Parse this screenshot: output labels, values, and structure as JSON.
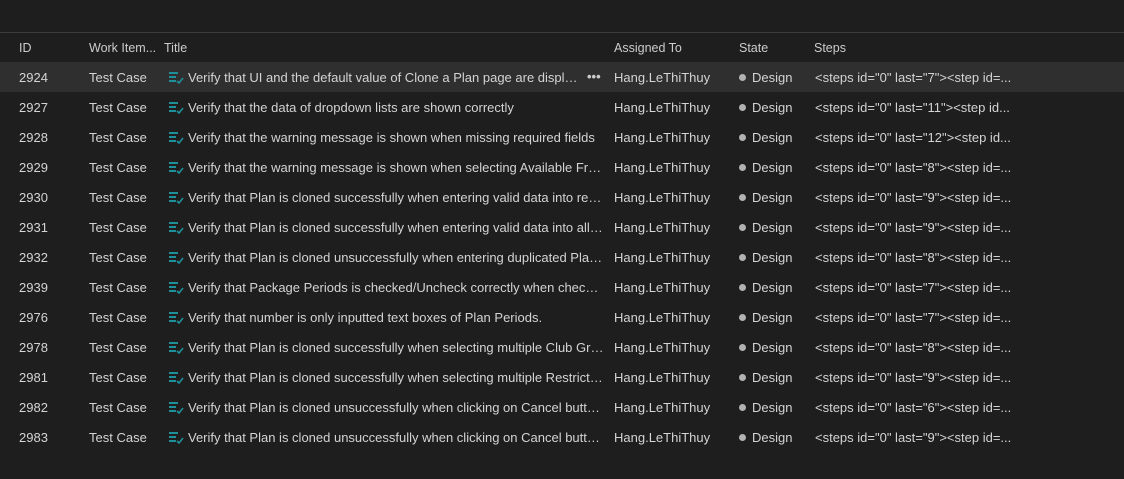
{
  "columns": {
    "id": "ID",
    "work_item_type": "Work Item...",
    "title": "Title",
    "assigned_to": "Assigned To",
    "state": "State",
    "steps": "Steps"
  },
  "colors": {
    "background": "#1e1e1e",
    "selected_row": "#2f2f2f",
    "icon_teal": "#1f8f9a",
    "state_dot": "#b2b2b2"
  },
  "rows": [
    {
      "id": "2924",
      "type": "Test Case",
      "title": "Verify that UI and the default value of Clone a Plan page are displa...",
      "assigned": "Hang.LeThiThuy",
      "state": "Design",
      "steps": "<steps id=\"0\" last=\"7\"><step id=...",
      "more": "•••"
    },
    {
      "id": "2927",
      "type": "Test Case",
      "title": "Verify that the data of dropdown lists are shown correctly",
      "assigned": "Hang.LeThiThuy",
      "state": "Design",
      "steps": "<steps id=\"0\" last=\"11\"><step id..."
    },
    {
      "id": "2928",
      "type": "Test Case",
      "title": "Verify that the warning message is shown when missing required fields",
      "assigned": "Hang.LeThiThuy",
      "state": "Design",
      "steps": "<steps id=\"0\" last=\"12\"><step id..."
    },
    {
      "id": "2929",
      "type": "Test Case",
      "title": "Verify that the warning message is shown when selecting Available Fro...",
      "assigned": "Hang.LeThiThuy",
      "state": "Design",
      "steps": "<steps id=\"0\" last=\"8\"><step id=..."
    },
    {
      "id": "2930",
      "type": "Test Case",
      "title": "Verify that Plan is cloned successfully when entering valid data into req...",
      "assigned": "Hang.LeThiThuy",
      "state": "Design",
      "steps": "<steps id=\"0\" last=\"9\"><step id=..."
    },
    {
      "id": "2931",
      "type": "Test Case",
      "title": "Verify that Plan is cloned successfully when entering valid data into all f...",
      "assigned": "Hang.LeThiThuy",
      "state": "Design",
      "steps": "<steps id=\"0\" last=\"9\"><step id=..."
    },
    {
      "id": "2932",
      "type": "Test Case",
      "title": "Verify that Plan is cloned unsuccessfully when entering duplicated Plan ...",
      "assigned": "Hang.LeThiThuy",
      "state": "Design",
      "steps": "<steps id=\"0\" last=\"8\"><step id=..."
    },
    {
      "id": "2939",
      "type": "Test Case",
      "title": "Verify that Package Periods is checked/Uncheck correctly when check/...",
      "assigned": "Hang.LeThiThuy",
      "state": "Design",
      "steps": "<steps id=\"0\" last=\"7\"><step id=..."
    },
    {
      "id": "2976",
      "type": "Test Case",
      "title": "Verify that number is only inputted text boxes of Plan Periods.",
      "assigned": "Hang.LeThiThuy",
      "state": "Design",
      "steps": "<steps id=\"0\" last=\"7\"><step id=..."
    },
    {
      "id": "2978",
      "type": "Test Case",
      "title": "Verify that Plan is cloned successfully when selecting multiple Club Gro...",
      "assigned": "Hang.LeThiThuy",
      "state": "Design",
      "steps": "<steps id=\"0\" last=\"8\"><step id=..."
    },
    {
      "id": "2981",
      "type": "Test Case",
      "title": "Verify that Plan is cloned successfully when selecting multiple Restrictio...",
      "assigned": "Hang.LeThiThuy",
      "state": "Design",
      "steps": "<steps id=\"0\" last=\"9\"><step id=..."
    },
    {
      "id": "2982",
      "type": "Test Case",
      "title": "Verify that Plan is cloned unsuccessfully when clicking on Cancel butto...",
      "assigned": "Hang.LeThiThuy",
      "state": "Design",
      "steps": "<steps id=\"0\" last=\"6\"><step id=..."
    },
    {
      "id": "2983",
      "type": "Test Case",
      "title": "Verify that Plan is cloned unsuccessfully when clicking on Cancel butto...",
      "assigned": "Hang.LeThiThuy",
      "state": "Design",
      "steps": "<steps id=\"0\" last=\"9\"><step id=..."
    }
  ]
}
